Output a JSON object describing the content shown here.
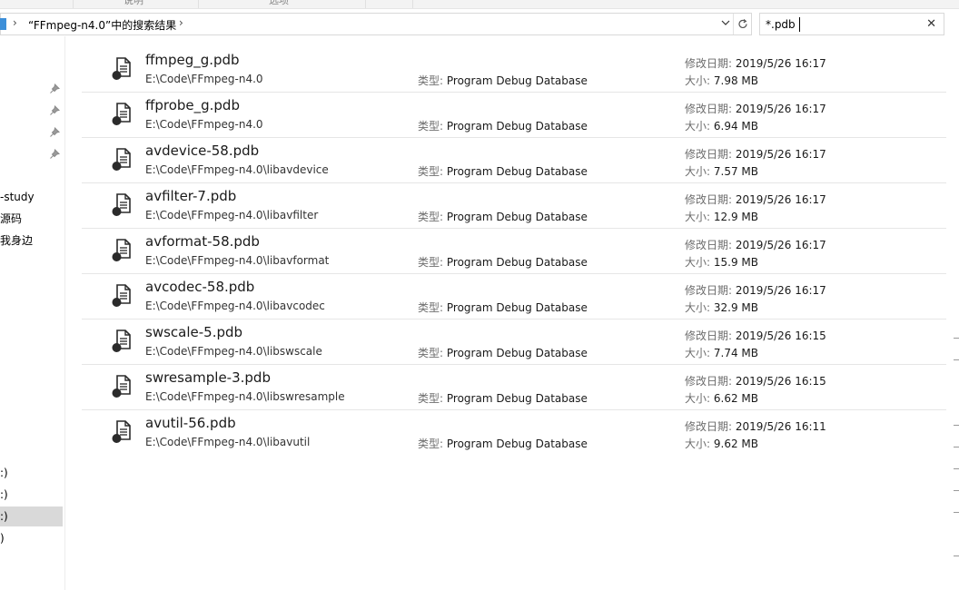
{
  "ribbon": {
    "tab_left": "说明",
    "tab_mid": "选项"
  },
  "address": {
    "breadcrumb": "“FFmpeg-n4.0”中的搜索结果"
  },
  "search": {
    "value": "*.pdb"
  },
  "nav": {
    "items": [
      {
        "label": "-study"
      },
      {
        "label": "源码"
      },
      {
        "label": "我身边"
      },
      {
        "label": ":)"
      },
      {
        "label": ":)"
      },
      {
        "label": ":)"
      },
      {
        "label": ")"
      }
    ]
  },
  "labels": {
    "type_key": "类型:",
    "date_key": "修改日期:",
    "size_key": "大小:"
  },
  "results": [
    {
      "name": "ffmpeg_g.pdb",
      "path": "E:\\Code\\FFmpeg-n4.0",
      "type": "Program Debug Database",
      "date": "2019/5/26 16:17",
      "size": "7.98 MB"
    },
    {
      "name": "ffprobe_g.pdb",
      "path": "E:\\Code\\FFmpeg-n4.0",
      "type": "Program Debug Database",
      "date": "2019/5/26 16:17",
      "size": "6.94 MB"
    },
    {
      "name": "avdevice-58.pdb",
      "path": "E:\\Code\\FFmpeg-n4.0\\libavdevice",
      "type": "Program Debug Database",
      "date": "2019/5/26 16:17",
      "size": "7.57 MB"
    },
    {
      "name": "avfilter-7.pdb",
      "path": "E:\\Code\\FFmpeg-n4.0\\libavfilter",
      "type": "Program Debug Database",
      "date": "2019/5/26 16:17",
      "size": "12.9 MB"
    },
    {
      "name": "avformat-58.pdb",
      "path": "E:\\Code\\FFmpeg-n4.0\\libavformat",
      "type": "Program Debug Database",
      "date": "2019/5/26 16:17",
      "size": "15.9 MB"
    },
    {
      "name": "avcodec-58.pdb",
      "path": "E:\\Code\\FFmpeg-n4.0\\libavcodec",
      "type": "Program Debug Database",
      "date": "2019/5/26 16:17",
      "size": "32.9 MB"
    },
    {
      "name": "swscale-5.pdb",
      "path": "E:\\Code\\FFmpeg-n4.0\\libswscale",
      "type": "Program Debug Database",
      "date": "2019/5/26 16:15",
      "size": "7.74 MB"
    },
    {
      "name": "swresample-3.pdb",
      "path": "E:\\Code\\FFmpeg-n4.0\\libswresample",
      "type": "Program Debug Database",
      "date": "2019/5/26 16:15",
      "size": "6.62 MB"
    },
    {
      "name": "avutil-56.pdb",
      "path": "E:\\Code\\FFmpeg-n4.0\\libavutil",
      "type": "Program Debug Database",
      "date": "2019/5/26 16:11",
      "size": "9.62 MB"
    }
  ]
}
